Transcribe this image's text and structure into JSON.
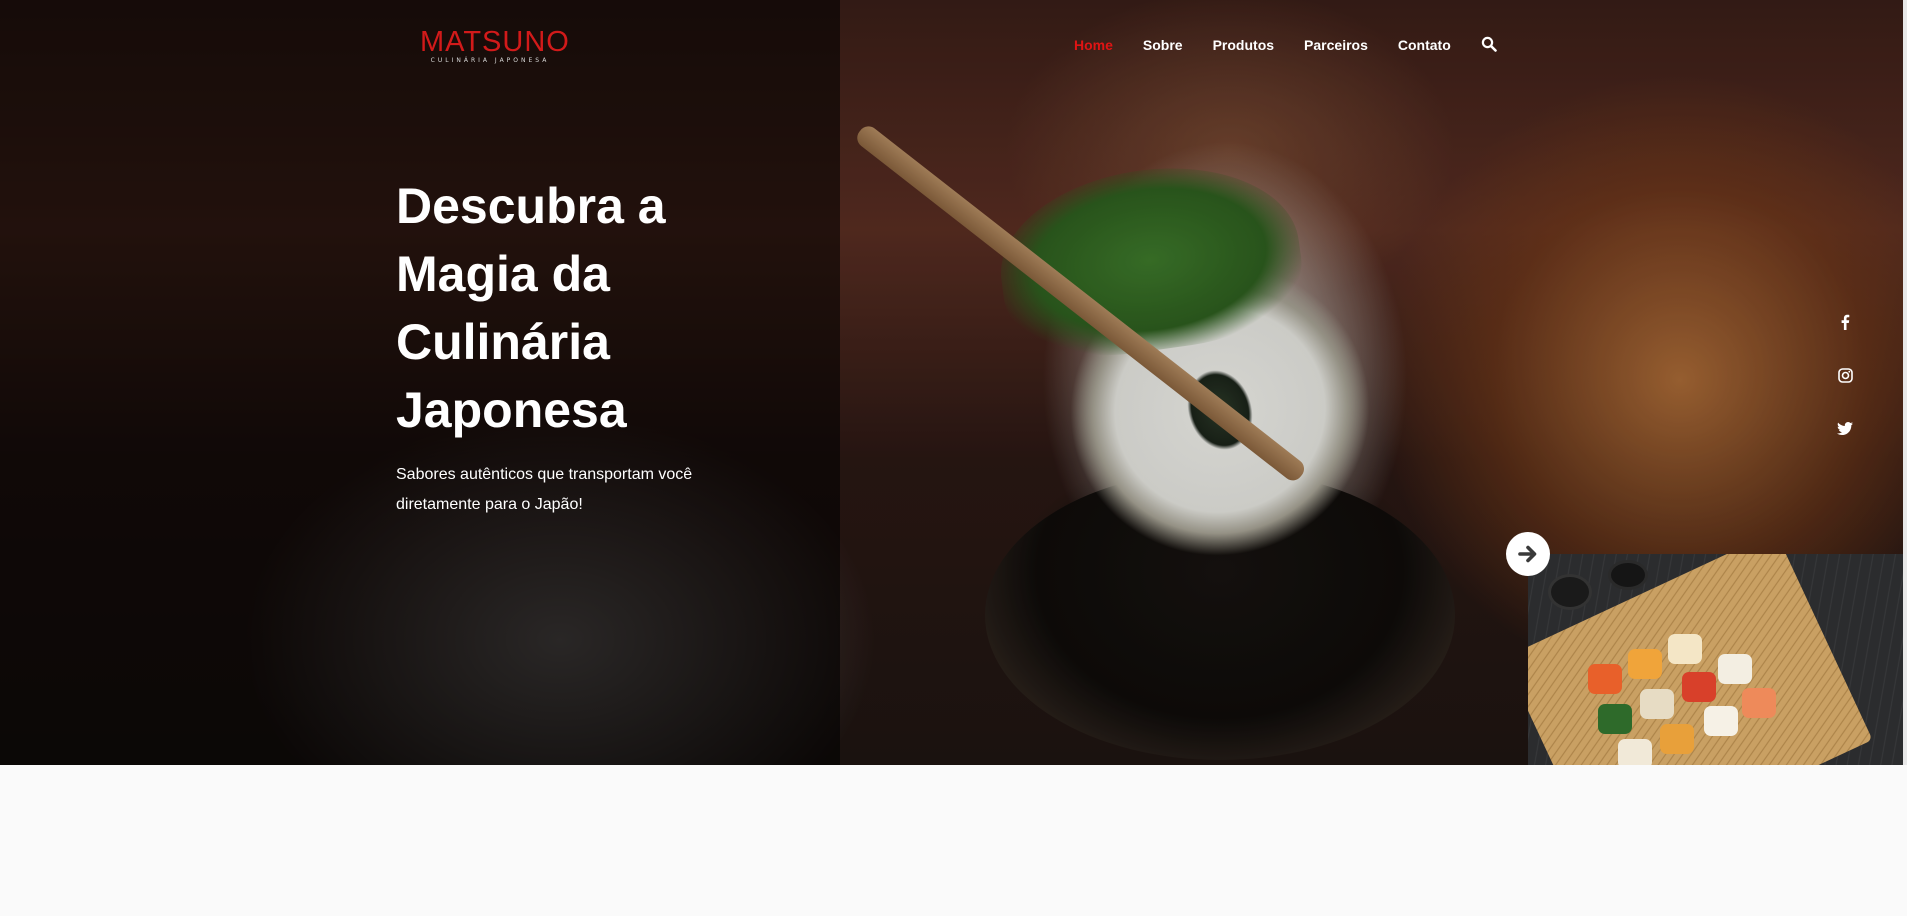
{
  "brand": {
    "name": "MATSUNO",
    "tagline": "CULINÁRIA JAPONESA",
    "accent_color": "#d21a1a"
  },
  "nav": {
    "items": [
      {
        "label": "Home",
        "active": true
      },
      {
        "label": "Sobre",
        "active": false
      },
      {
        "label": "Produtos",
        "active": false
      },
      {
        "label": "Parceiros",
        "active": false
      },
      {
        "label": "Contato",
        "active": false
      }
    ],
    "search_icon": "search-icon"
  },
  "hero": {
    "headline_lines": [
      "Descubra a",
      "Magia da",
      "Culinária",
      "Japonesa"
    ],
    "subtitle": "Sabores autênticos que transportam você diretamente para o Japão!"
  },
  "social": [
    "facebook-icon",
    "instagram-icon",
    "twitter-icon"
  ],
  "slider": {
    "next_icon": "arrow-right-icon"
  }
}
